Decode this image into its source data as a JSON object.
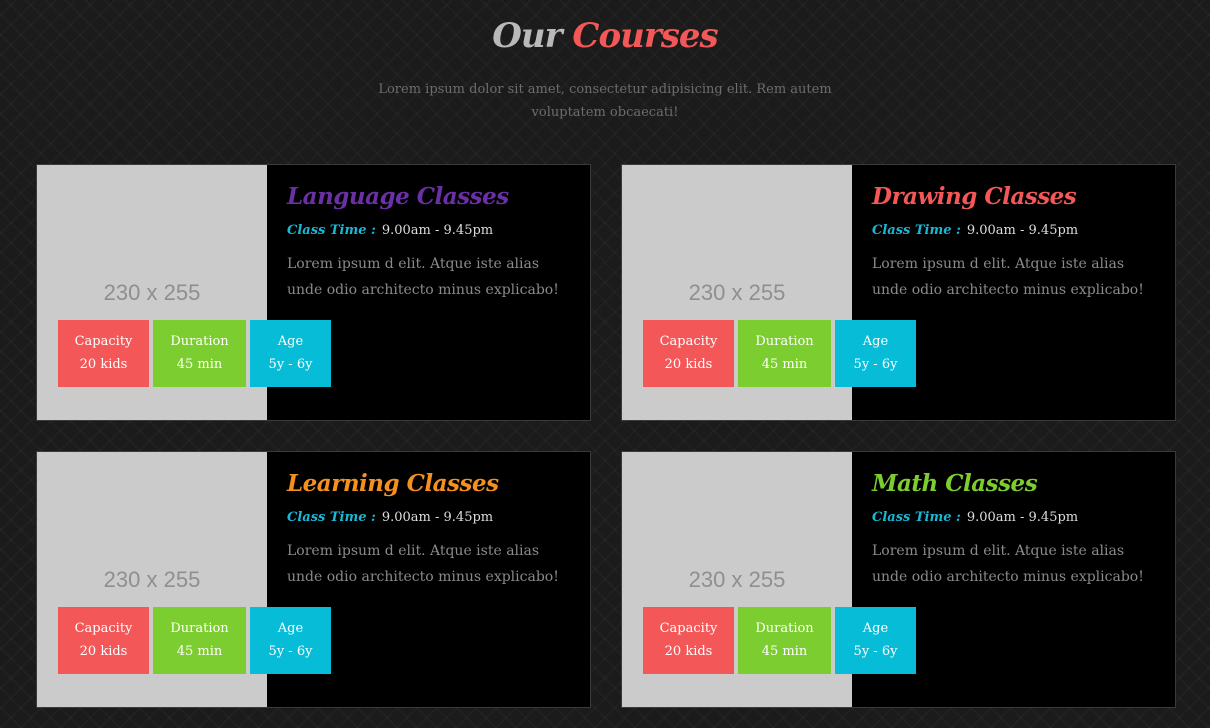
{
  "header": {
    "title_word1": "Our",
    "title_word2": "Courses",
    "subtitle": "Lorem ipsum dolor sit amet, consectetur adipisicing elit. Rem autem voluptatem obcaecati!"
  },
  "colors": {
    "accent_red": "#f45757",
    "accent_green": "#7ccd2f",
    "accent_cyan": "#06bcd7",
    "purple": "#6b2fa6",
    "orange": "#f5901e"
  },
  "courses": [
    {
      "title": "Language Classes",
      "title_color": "#6b2fa6",
      "image_placeholder": "230 x 255",
      "time_label": "Class Time :",
      "time_value": "9.00am - 9.45pm",
      "description": "Lorem ipsum d elit. Atque iste alias unde odio architecto minus explicabo!",
      "capacity_label": "Capacity",
      "capacity_value": "20 kids",
      "duration_label": "Duration",
      "duration_value": "45 min",
      "age_label": "Age",
      "age_value": "5y - 6y"
    },
    {
      "title": "Drawing Classes",
      "title_color": "#f45757",
      "image_placeholder": "230 x 255",
      "time_label": "Class Time :",
      "time_value": "9.00am - 9.45pm",
      "description": "Lorem ipsum d elit. Atque iste alias unde odio architecto minus explicabo!",
      "capacity_label": "Capacity",
      "capacity_value": "20 kids",
      "duration_label": "Duration",
      "duration_value": "45 min",
      "age_label": "Age",
      "age_value": "5y - 6y"
    },
    {
      "title": "Learning Classes",
      "title_color": "#f5901e",
      "image_placeholder": "230 x 255",
      "time_label": "Class Time :",
      "time_value": "9.00am - 9.45pm",
      "description": "Lorem ipsum d elit. Atque iste alias unde odio architecto minus explicabo!",
      "capacity_label": "Capacity",
      "capacity_value": "20 kids",
      "duration_label": "Duration",
      "duration_value": "45 min",
      "age_label": "Age",
      "age_value": "5y - 6y"
    },
    {
      "title": "Math Classes",
      "title_color": "#7ccd2f",
      "image_placeholder": "230 x 255",
      "time_label": "Class Time :",
      "time_value": "9.00am - 9.45pm",
      "description": "Lorem ipsum d elit. Atque iste alias unde odio architecto minus explicabo!",
      "capacity_label": "Capacity",
      "capacity_value": "20 kids",
      "duration_label": "Duration",
      "duration_value": "45 min",
      "age_label": "Age",
      "age_value": "5y - 6y"
    }
  ]
}
